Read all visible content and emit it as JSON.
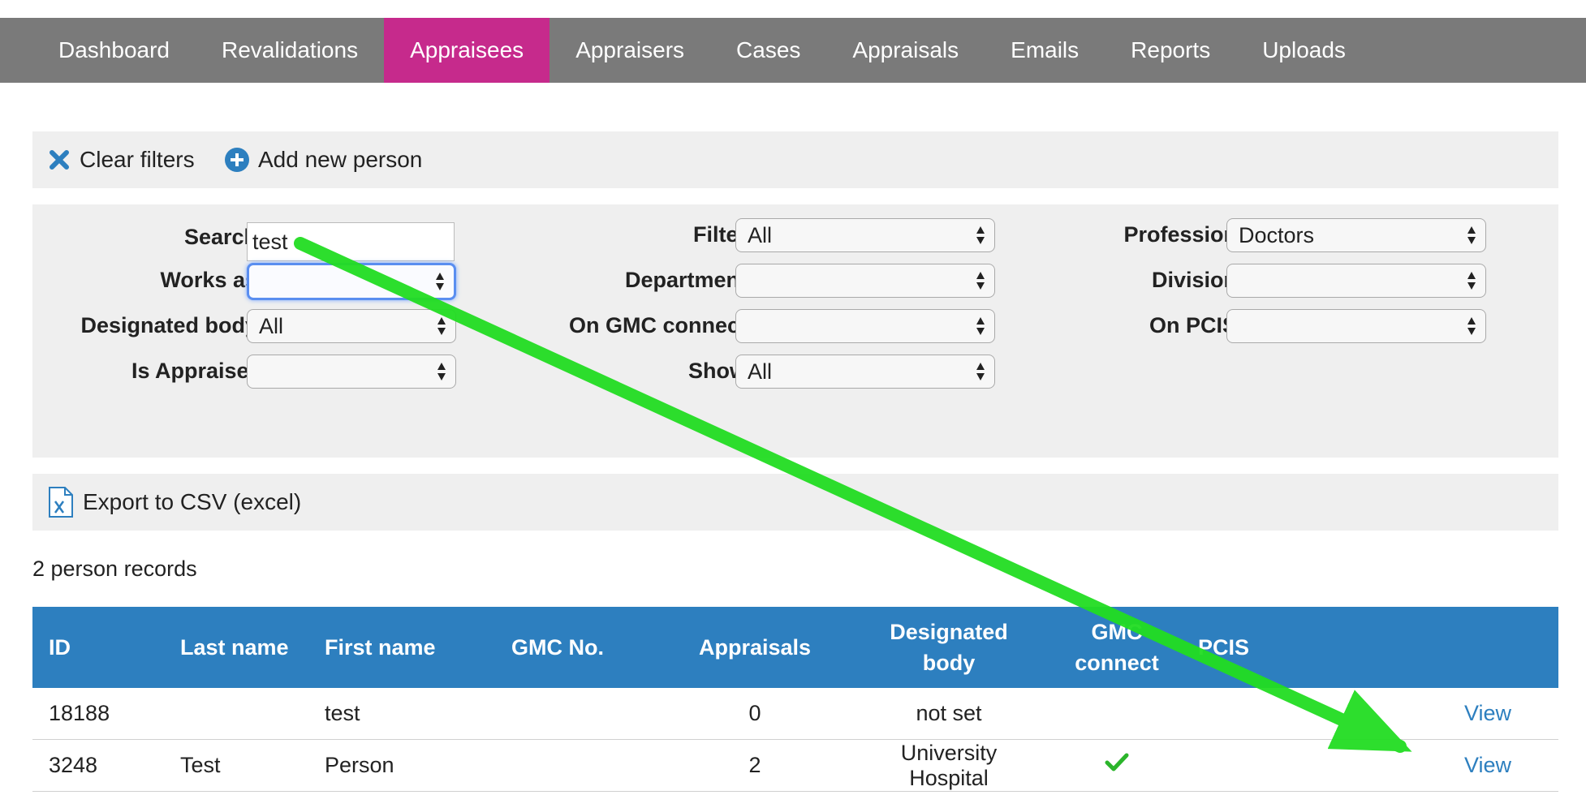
{
  "nav": {
    "tabs": [
      {
        "label": "Dashboard"
      },
      {
        "label": "Revalidations"
      },
      {
        "label": "Appraisees",
        "active": true
      },
      {
        "label": "Appraisers"
      },
      {
        "label": "Cases"
      },
      {
        "label": "Appraisals"
      },
      {
        "label": "Emails"
      },
      {
        "label": "Reports"
      },
      {
        "label": "Uploads"
      }
    ]
  },
  "actions": {
    "clear_filters": "Clear filters",
    "add_person": "Add new person"
  },
  "filters": {
    "search_label": "Search:",
    "search_value": "test",
    "works_as_label": "Works as:",
    "works_as_value": "",
    "designated_body_label": "Designated body:",
    "designated_body_value": "All",
    "is_appraiser_label": "Is Appraiser:",
    "is_appraiser_value": "",
    "filter_label": "Filter:",
    "filter_value": "All",
    "department_label": "Department:",
    "department_value": "",
    "gmc_connect_label": "On GMC connect:",
    "gmc_connect_value": "",
    "show_label": "Show:",
    "show_value": "All",
    "profession_label": "Profession:",
    "profession_value": "Doctors",
    "division_label": "Division:",
    "division_value": "",
    "pcis_label": "On PCIS:",
    "pcis_value": ""
  },
  "export": {
    "label": "Export to CSV (excel)"
  },
  "records": {
    "count_text": "2 person records"
  },
  "table": {
    "headers": {
      "id": "ID",
      "last_name": "Last name",
      "first_name": "First name",
      "gmc_no": "GMC No.",
      "appraisals": "Appraisals",
      "designated_body": "Designated body",
      "gmc_connect_line1": "GMC",
      "gmc_connect_line2": "connect",
      "pcis": "PCIS"
    },
    "rows": [
      {
        "id": "18188",
        "last_name": "",
        "first_name": "test",
        "gmc_no": "",
        "appraisals": "0",
        "designated_body": "not set",
        "gmc_connect": false,
        "pcis": "",
        "action": "View"
      },
      {
        "id": "3248",
        "last_name": "Test",
        "first_name": "Person",
        "gmc_no": "",
        "appraisals": "2",
        "designated_body": "University Hospital",
        "gmc_connect": true,
        "pcis": "",
        "action": "View"
      }
    ]
  },
  "colors": {
    "nav_bg": "#7a7a7a",
    "nav_active": "#c62a8c",
    "table_header": "#2d7fbf",
    "link": "#2d7fbf",
    "annotation_arrow": "#22dd22"
  }
}
